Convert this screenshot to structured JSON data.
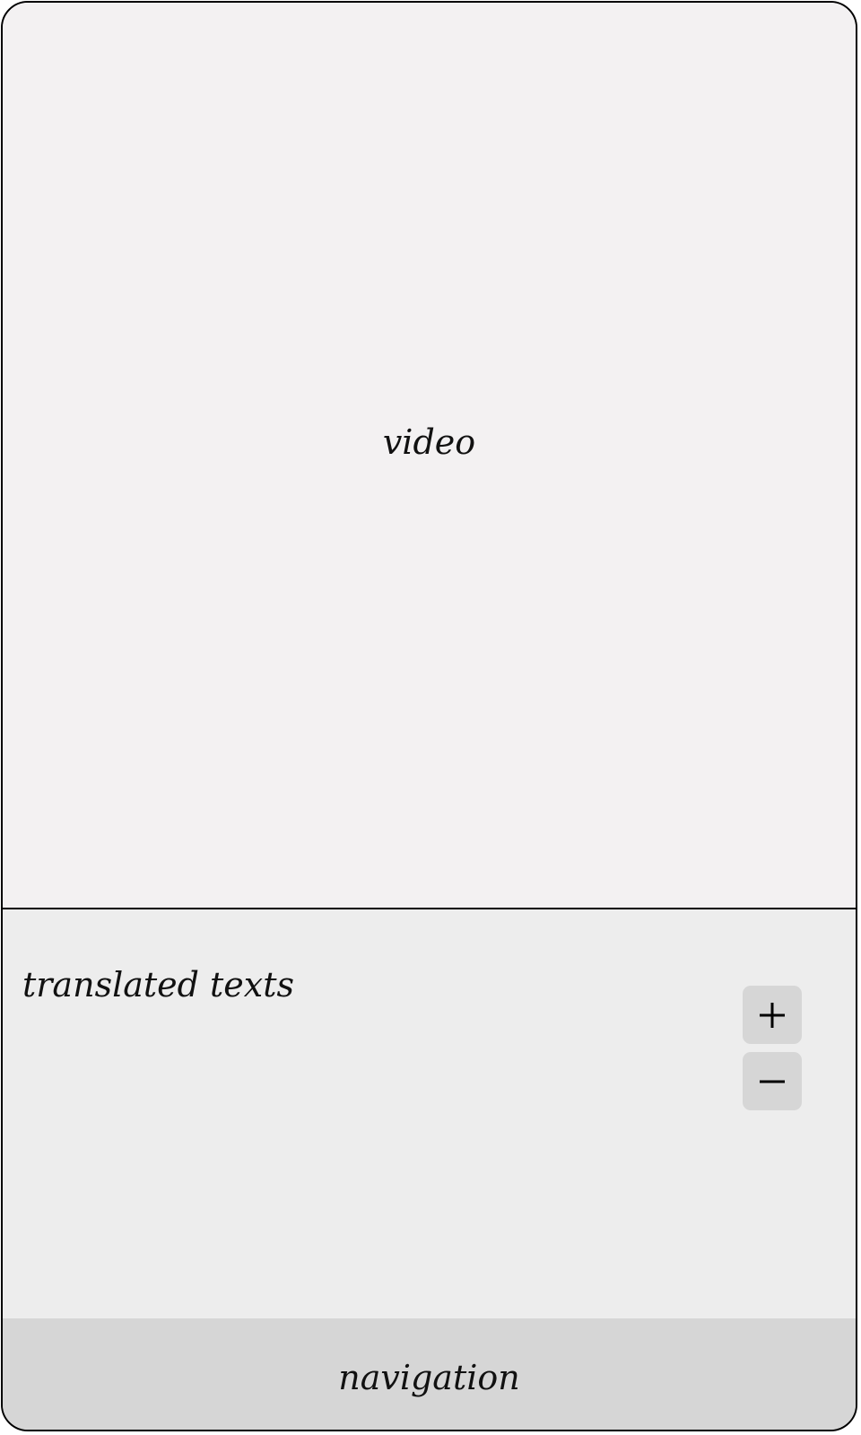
{
  "video": {
    "label": "video"
  },
  "subtitles": {
    "label": "translated texts",
    "zoom_in_icon": "plus-icon",
    "zoom_out_icon": "minus-icon"
  },
  "navigation": {
    "label": "navigation"
  },
  "colors": {
    "video_bg": "#f3f1f2",
    "text_area_bg": "#ededed",
    "button_bg": "#d6d6d6",
    "nav_bg": "#d6d6d6",
    "border": "#000000"
  }
}
